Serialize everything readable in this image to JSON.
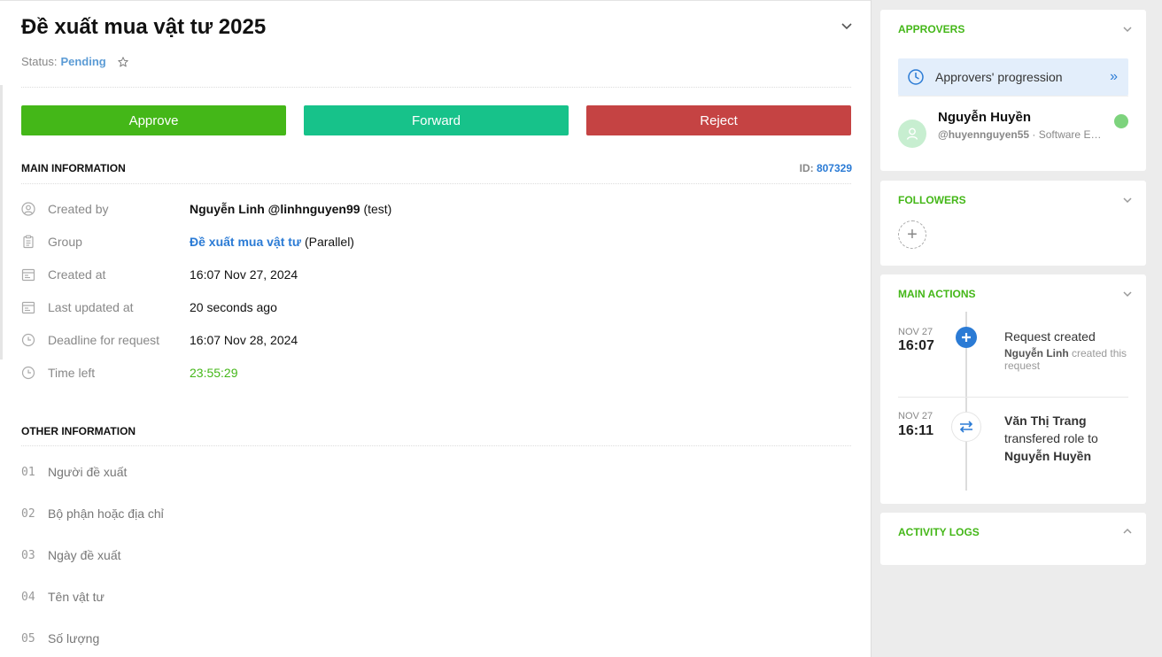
{
  "request": {
    "title": "Đề xuất mua vật tư 2025",
    "status_label": "Status:",
    "status_value": "Pending"
  },
  "actions": {
    "approve": "Approve",
    "forward": "Forward",
    "reject": "Reject"
  },
  "main_info": {
    "heading": "MAIN INFORMATION",
    "id_label": "ID:",
    "id_value": "807329",
    "rows": [
      {
        "label": "Created by",
        "value_name": "Nguyễn Linh",
        "value_user": "@linhnguyen99",
        "value_extra": "(test)",
        "icon": "user-icon"
      },
      {
        "label": "Group",
        "value_link": "Đề xuất mua vật tư",
        "value_extra": "(Parallel)",
        "icon": "clipboard-icon"
      },
      {
        "label": "Created at",
        "value": "16:07 Nov 27, 2024",
        "icon": "calendar-icon"
      },
      {
        "label": "Last updated at",
        "value": "20 seconds ago",
        "icon": "calendar-icon"
      },
      {
        "label": "Deadline for request",
        "value": "16:07 Nov 28, 2024",
        "icon": "clock-icon"
      },
      {
        "label": "Time left",
        "value": "23:55:29",
        "icon": "clock-icon"
      }
    ]
  },
  "other_info": {
    "heading": "OTHER INFORMATION",
    "rows": [
      {
        "num": "01",
        "label": "Người đề xuất"
      },
      {
        "num": "02",
        "label": "Bộ phận hoặc địa chỉ"
      },
      {
        "num": "03",
        "label": "Ngày đề xuất"
      },
      {
        "num": "04",
        "label": "Tên vật tư"
      },
      {
        "num": "05",
        "label": "Số lượng"
      }
    ]
  },
  "approvers": {
    "heading": "APPROVERS",
    "progression": "Approvers' progression",
    "person": {
      "name": "Nguyễn Huyền",
      "username": "@huyennguyen55",
      "separator": "·",
      "role": "Software Eng..."
    }
  },
  "followers": {
    "heading": "FOLLOWERS",
    "add": "+"
  },
  "main_actions": {
    "heading": "MAIN ACTIONS",
    "items": [
      {
        "date": "NOV 27",
        "time": "16:07",
        "title": "Request created",
        "actor": "Nguyễn Linh",
        "desc": "created this request"
      },
      {
        "date": "NOV 27",
        "time": "16:11",
        "from": "Văn Thị Trang",
        "action": "transfered role to",
        "to": "Nguyễn Huyền"
      }
    ]
  },
  "activity_logs": {
    "heading": "ACTIVITY LOGS"
  },
  "colors": {
    "approve": "#44b718",
    "forward": "#17c28a",
    "reject": "#c54343",
    "accent_green": "#44b718",
    "link_blue": "#2b7bd5"
  }
}
